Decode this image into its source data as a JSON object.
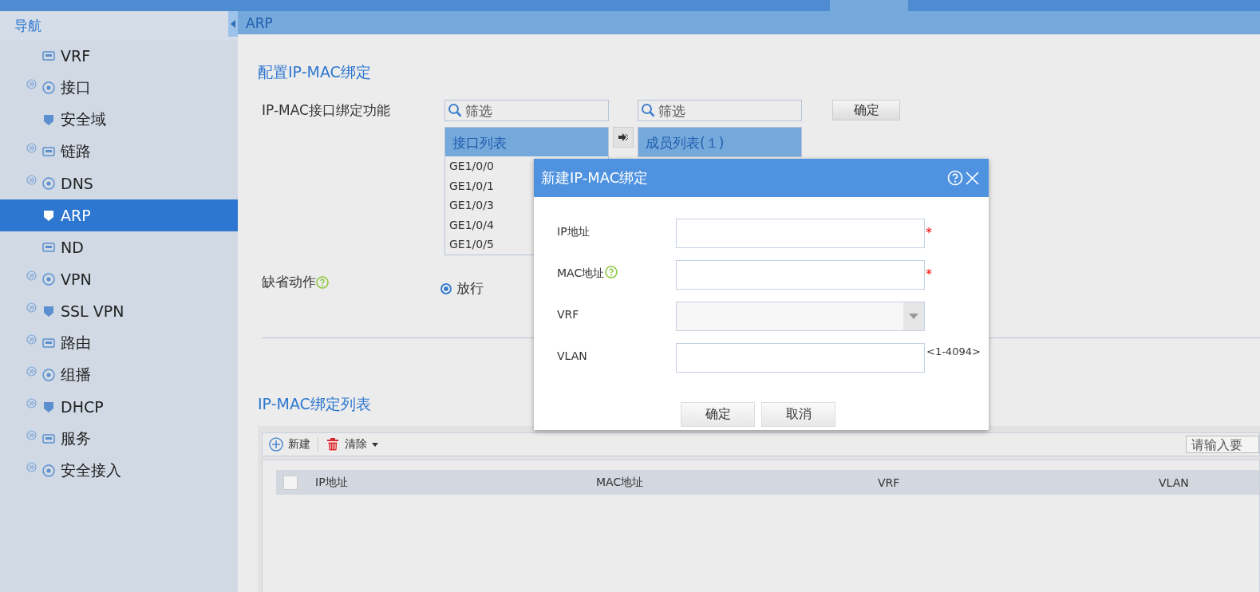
{
  "sidebar": {
    "title": "导航",
    "items": [
      {
        "label": "VRF",
        "expandable": false,
        "selected": false
      },
      {
        "label": "接口",
        "expandable": true,
        "selected": false
      },
      {
        "label": "安全域",
        "expandable": false,
        "selected": false
      },
      {
        "label": "链路",
        "expandable": true,
        "selected": false
      },
      {
        "label": "DNS",
        "expandable": true,
        "selected": false
      },
      {
        "label": "ARP",
        "expandable": false,
        "selected": true
      },
      {
        "label": "ND",
        "expandable": false,
        "selected": false
      },
      {
        "label": "VPN",
        "expandable": true,
        "selected": false
      },
      {
        "label": "SSL VPN",
        "expandable": true,
        "selected": false
      },
      {
        "label": "路由",
        "expandable": true,
        "selected": false
      },
      {
        "label": "组播",
        "expandable": true,
        "selected": false
      },
      {
        "label": "DHCP",
        "expandable": true,
        "selected": false
      },
      {
        "label": "服务",
        "expandable": true,
        "selected": false
      },
      {
        "label": "安全接入",
        "expandable": true,
        "selected": false
      }
    ]
  },
  "page_title": "ARP",
  "config": {
    "title": "配置IP-MAC绑定",
    "binding_label": "IP-MAC接口绑定功能",
    "left_filter": {
      "placeholder": "筛选"
    },
    "right_filter": {
      "placeholder": "筛选"
    },
    "left_list": {
      "title": "接口列表",
      "items": [
        "GE1/0/0",
        "GE1/0/1",
        "GE1/0/3",
        "GE1/0/4",
        "GE1/0/5"
      ]
    },
    "right_list": {
      "title": "成员列表(１)"
    },
    "confirm": "确定",
    "default_action_label": "缺省动作",
    "radio_options": [
      {
        "label": "放行",
        "selected": true
      }
    ]
  },
  "binding_list": {
    "title": "IP-MAC绑定列表",
    "toolbar": [
      "新建",
      "清除"
    ],
    "search": {
      "placeholder": "请输入要"
    },
    "select_all_checked": false,
    "columns": [
      "IP地址",
      "MAC地址",
      "VRF",
      "VLAN"
    ]
  },
  "dialog": {
    "title": "新建IP-MAC绑定",
    "fields": [
      {
        "kind": "text",
        "label": "IP地址",
        "required_mark": "*",
        "help": false
      },
      {
        "kind": "text",
        "label": "MAC地址",
        "required_mark": "*",
        "help": true
      },
      {
        "kind": "select",
        "label": "VRF",
        "help": false
      },
      {
        "kind": "text",
        "label": "VLAN",
        "help": false,
        "hint": "<1-4094>"
      }
    ],
    "buttons": [
      "确定",
      "取消"
    ]
  }
}
